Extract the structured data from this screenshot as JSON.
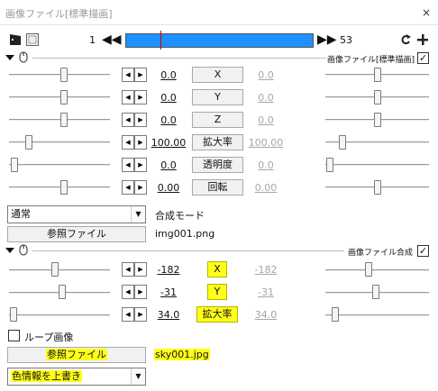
{
  "window": {
    "title": "画像ファイル[標準描画]",
    "close": "×"
  },
  "timeline": {
    "start_frame": "1",
    "end_frame": "53",
    "prev": "◀◀",
    "next": "▶▶"
  },
  "section1": {
    "title": "画像ファイル[標準描画]",
    "checked": "✓"
  },
  "section2": {
    "title": "画像ファイル合成",
    "checked": "✓"
  },
  "rows1": [
    {
      "left": "0.0",
      "label": "X",
      "right": "0.0"
    },
    {
      "left": "0.0",
      "label": "Y",
      "right": "0.0"
    },
    {
      "left": "0.0",
      "label": "Z",
      "right": "0.0"
    },
    {
      "left": "100.00",
      "label": "拡大率",
      "right": "100.00"
    },
    {
      "left": "0.0",
      "label": "透明度",
      "right": "0.0"
    },
    {
      "left": "0.00",
      "label": "回転",
      "right": "0.00"
    }
  ],
  "blend": {
    "value": "通常",
    "label": "合成モード"
  },
  "file1": {
    "button": "参照ファイル",
    "name": "img001.png"
  },
  "rows2": [
    {
      "left": "-182",
      "label": "X",
      "right": "-182"
    },
    {
      "left": "-31",
      "label": "Y",
      "right": "-31"
    },
    {
      "left": "34.0",
      "label": "拡大率",
      "right": "34.0"
    }
  ],
  "loop": {
    "label": "ループ画像"
  },
  "file2": {
    "button": "参照ファイル",
    "name": "sky001.jpg"
  },
  "mode2": {
    "value": "色情報を上書き"
  },
  "highlight_color": "#ffff1a"
}
